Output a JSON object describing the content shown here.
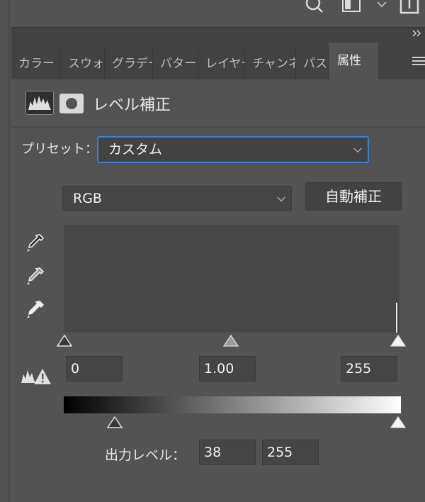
{
  "tabs": [
    {
      "label": "カラー"
    },
    {
      "label": "スウォッチ"
    },
    {
      "label": "グラデーション"
    },
    {
      "label": "パターン"
    },
    {
      "label": "レイヤー"
    },
    {
      "label": "チャンネル"
    },
    {
      "label": "パス"
    },
    {
      "label": "属性"
    }
  ],
  "active_tab": "属性",
  "header": {
    "title": "レベル補正"
  },
  "preset": {
    "label": "プリセット：",
    "value": "カスタム"
  },
  "channel": {
    "value": "RGB"
  },
  "auto_button": {
    "label": "自動補正"
  },
  "input_levels": {
    "shadow": "0",
    "midtone": "1.00",
    "highlight": "255"
  },
  "output_levels": {
    "label": "出力レベル：",
    "low": "38",
    "high": "255"
  },
  "colors": {
    "panel": "#535353",
    "tabbar": "#424242",
    "focus": "#3e7bd4",
    "field": "#454545"
  }
}
